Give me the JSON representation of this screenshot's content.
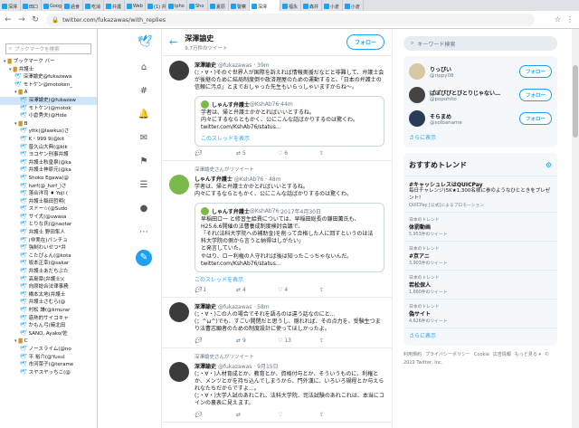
{
  "browser": {
    "tabs": [
      {
        "label": "深澤"
      },
      {
        "label": "田口"
      },
      {
        "label": "Goog"
      },
      {
        "label": "過食"
      },
      {
        "label": "吃消"
      },
      {
        "label": "弁護"
      },
      {
        "label": "Web"
      },
      {
        "label": "(1) 弁"
      },
      {
        "label": "ipho"
      },
      {
        "label": "Sho"
      },
      {
        "label": "夏原"
      },
      {
        "label": "警察"
      },
      {
        "label": "深澤",
        "active": true
      },
      {
        "label": "福永"
      },
      {
        "label": "森井"
      },
      {
        "label": "小倉"
      },
      {
        "label": "小倉"
      }
    ],
    "url": "twitter.com/fukazawas/with_replies"
  },
  "bookmarks": {
    "search_placeholder": "ブックマークを検索",
    "items": [
      {
        "type": "folder",
        "label": "ブックマーク バー",
        "indent": 0
      },
      {
        "type": "folder",
        "label": "弁護士",
        "indent": 1
      },
      {
        "type": "link",
        "label": "深澤諭史@fukazawa",
        "indent": 2
      },
      {
        "type": "link",
        "label": "モトケン@motoken_",
        "indent": 2
      },
      {
        "type": "folder",
        "label": "A",
        "indent": 2
      },
      {
        "type": "link",
        "label": "深澤諭史(@fukazaw",
        "indent": 3,
        "selected": true
      },
      {
        "type": "link",
        "label": "モトケン(@motok",
        "indent": 3
      },
      {
        "type": "link",
        "label": "小倉秀夫(@Hide",
        "indent": 3
      },
      {
        "type": "folder",
        "label": "B",
        "indent": 2
      },
      {
        "type": "link",
        "label": "yttk(@lawkus)さ",
        "indent": 3
      },
      {
        "type": "link",
        "label": "K・999 9(@kit",
        "indent": 3
      },
      {
        "type": "link",
        "label": "普久山大典(@kik",
        "indent": 3
      },
      {
        "type": "link",
        "label": "ヨコヤン刑事弁護",
        "indent": 3
      },
      {
        "type": "link",
        "label": "弁護士秋皇泉(@ka",
        "indent": 3
      },
      {
        "type": "link",
        "label": "弁護士神原元(@ka",
        "indent": 3
      },
      {
        "type": "link",
        "label": "Shoko Egawa(@",
        "indent": 3
      },
      {
        "type": "link",
        "label": "hzrf(@_hzrf_)さ",
        "indent": 3
      },
      {
        "type": "link",
        "label": "落合洋司 ♦ Yoji (",
        "indent": 3
      },
      {
        "type": "link",
        "label": "弁護士稲田哲明(",
        "indent": 3
      },
      {
        "type": "link",
        "label": "スドー☆(@Sudo",
        "indent": 3
      },
      {
        "type": "link",
        "label": "サイ犬(@uwasa",
        "indent": 3
      },
      {
        "type": "link",
        "label": "とりな氏(@naotar",
        "indent": 3
      },
      {
        "type": "link",
        "label": "弁護士 野田隼人",
        "indent": 3
      },
      {
        "type": "link",
        "label": "(非実在)パンチョ",
        "indent": 3
      },
      {
        "type": "link",
        "label": "強制わいせつ*弁",
        "indent": 3
      },
      {
        "type": "link",
        "label": "こたぴょん(@kota",
        "indent": 3
      },
      {
        "type": "link",
        "label": "坂本正幸(@sakar",
        "indent": 3
      },
      {
        "type": "link",
        "label": "弁護士あだちぶた",
        "indent": 3
      },
      {
        "type": "link",
        "label": "高島章(弁護士)(",
        "indent": 3
      },
      {
        "type": "link",
        "label": "向原総合法律事務",
        "indent": 3
      },
      {
        "type": "link",
        "label": "橋本太地(弁護士",
        "indent": 3
      },
      {
        "type": "link",
        "label": "弁護士さむら(@",
        "indent": 3
      },
      {
        "type": "link",
        "label": "村松 謙(@kmurar",
        "indent": 3
      },
      {
        "type": "link",
        "label": "惑熱的サイコキャ",
        "indent": 3
      },
      {
        "type": "link",
        "label": "かもん弓(暁北田",
        "indent": 3
      },
      {
        "type": "link",
        "label": "SANO, Ayako/佐",
        "indent": 3
      },
      {
        "type": "folder",
        "label": "C",
        "indent": 2
      },
      {
        "type": "link",
        "label": "ノースライム(@no",
        "indent": 3
      },
      {
        "type": "link",
        "label": "平 裕介(@Yusul",
        "indent": 3
      },
      {
        "type": "link",
        "label": "市河菜子(@terame",
        "indent": 3
      },
      {
        "type": "link",
        "label": "スヤスヤッちこ(@",
        "indent": 3
      }
    ]
  },
  "timeline": {
    "header_name": "深澤諭史",
    "header_count": "9.7万件のツイート",
    "follow_label": "フォロー",
    "tweets": [
      {
        "name": "深澤諭史",
        "handle": "@fukazawas",
        "time": "39m",
        "text": "(；・∀・)そのぐ世界人が国際を訴えれば情報奥援だなどと非難して、弁護士会が後継のために結局制度倒や政済理屋のための運動すると、「日本の弁護士の信頼に汚点」とまでおしゃった先生もいらっしゃいますからね～。",
        "quote": {
          "name": "しゃんす弁護士",
          "handle": "@KshAb76",
          "time": "44m",
          "text": "学者は、帰と弁護士かかとればいいとするね。\n内々にするならともかく、公にこんな話ばかりするのは驚くわ。\ntwitter.com/KshAb76/status…",
          "thread_link": "このスレッドを表示"
        },
        "replies": "",
        "retweets": "5",
        "likes": "6"
      },
      {
        "rt_note": "深澤諭史さんがリツイート",
        "name": "しゃんす弁護士",
        "handle": "@KshAb76",
        "time": "48m",
        "alt_avatar": true,
        "text": "学者は、帰と弁護士かかとればいいとするね。\n内々にするならともかく、公にこんな話ばかりするのは驚くわ。",
        "quote": {
          "name": "しゃんす弁護士",
          "handle": "@KshAb76",
          "time": "2017年4月30日",
          "text": "早稲田ロー と修習生給費については、早稲田総長の鎌田薫氏も、H25.6.6開催の法曹養成制度検討会議で、\n「それ(法科大学院への補助金)を削って合格した人に回すというのは法科大学院の側から言うと納得はしがたい」\nと発言していた。\nやはり、ロー利権の人守れれば後は知ったこっちゃないんだ。\ntwitter.com/KshAb76/status…",
          "thread_link": ""
        },
        "thread_link": "このスレッドを表示",
        "replies": "1",
        "retweets": "4",
        "likes": "4"
      },
      {
        "name": "深澤諭史",
        "handle": "@fukazawas",
        "time": "58m",
        "text": "(；・∀・)この人の場合でそれを語るのは違う話なのにと…\n(；^ω^)でも、すごい開閉だと思うし、隠れれば、その点力を、受験生つまり法曹志願者のための制度設計に使ってほしかったよ。",
        "replies": "",
        "retweets": "9",
        "likes": "13"
      },
      {
        "rt_note": "深澤諭史さんがリツイート",
        "name": "深澤諭史",
        "handle": "@fukazawas",
        "time": "9月15日",
        "text": "(；・∀・)人材育成とか、教育とか、資格付与とか、そういうものに、利権とか、メンツとかを持ち込んでしまうから、門外漢に、いろいろ規程とか与えられなたちだからですよ…。\n(；・∀・)大学人試のあれこれ、法科大学院、司法試験のあれこれは、本当にコインの裏表に見えます。",
        "replies": "",
        "retweets": "",
        "likes": ""
      }
    ]
  },
  "right": {
    "search_placeholder": "キーワード検索",
    "who_to_follow": [
      {
        "name": "りっぴい",
        "handle": "@rippy08",
        "follow_label": "フォロー"
      },
      {
        "name": "ぱぽぴぴとびとりじゃない…",
        "handle": "@popohito",
        "follow_label": "フォロー"
      },
      {
        "name": "そらまめ",
        "handle": "@solbaname",
        "follow_label": "フォロー"
      }
    ],
    "more_label": "さらに表示",
    "trends_title": "おすすめトレンド",
    "trends": [
      {
        "cat": "",
        "name": "#キャッシュレスはQUICPay",
        "desc": "毎日チャレンジ(5K★1,300名様に参のようなひとときをプレゼント!",
        "cnt": "QUICPay [公式]によるプロモーション"
      },
      {
        "cat": "日本のトレンド",
        "name": "体罰動画",
        "cnt": "5,953件のツイート"
      },
      {
        "cat": "日本のトレンド",
        "name": "#京アニ",
        "cnt": "3,903件のツイート"
      },
      {
        "cat": "日本のトレンド",
        "name": "若松保人",
        "cnt": "1,660件のツイート"
      },
      {
        "cat": "日本のトレンド",
        "name": "偽サイト",
        "cnt": "4,626件のツイート"
      }
    ],
    "trends_more": "さらに表示",
    "footer": [
      "利用規約",
      "プライバシーポリシー",
      "Cookie",
      "広告情報",
      "もっと見る ▾",
      "© 2019 Twitter, Inc."
    ]
  }
}
